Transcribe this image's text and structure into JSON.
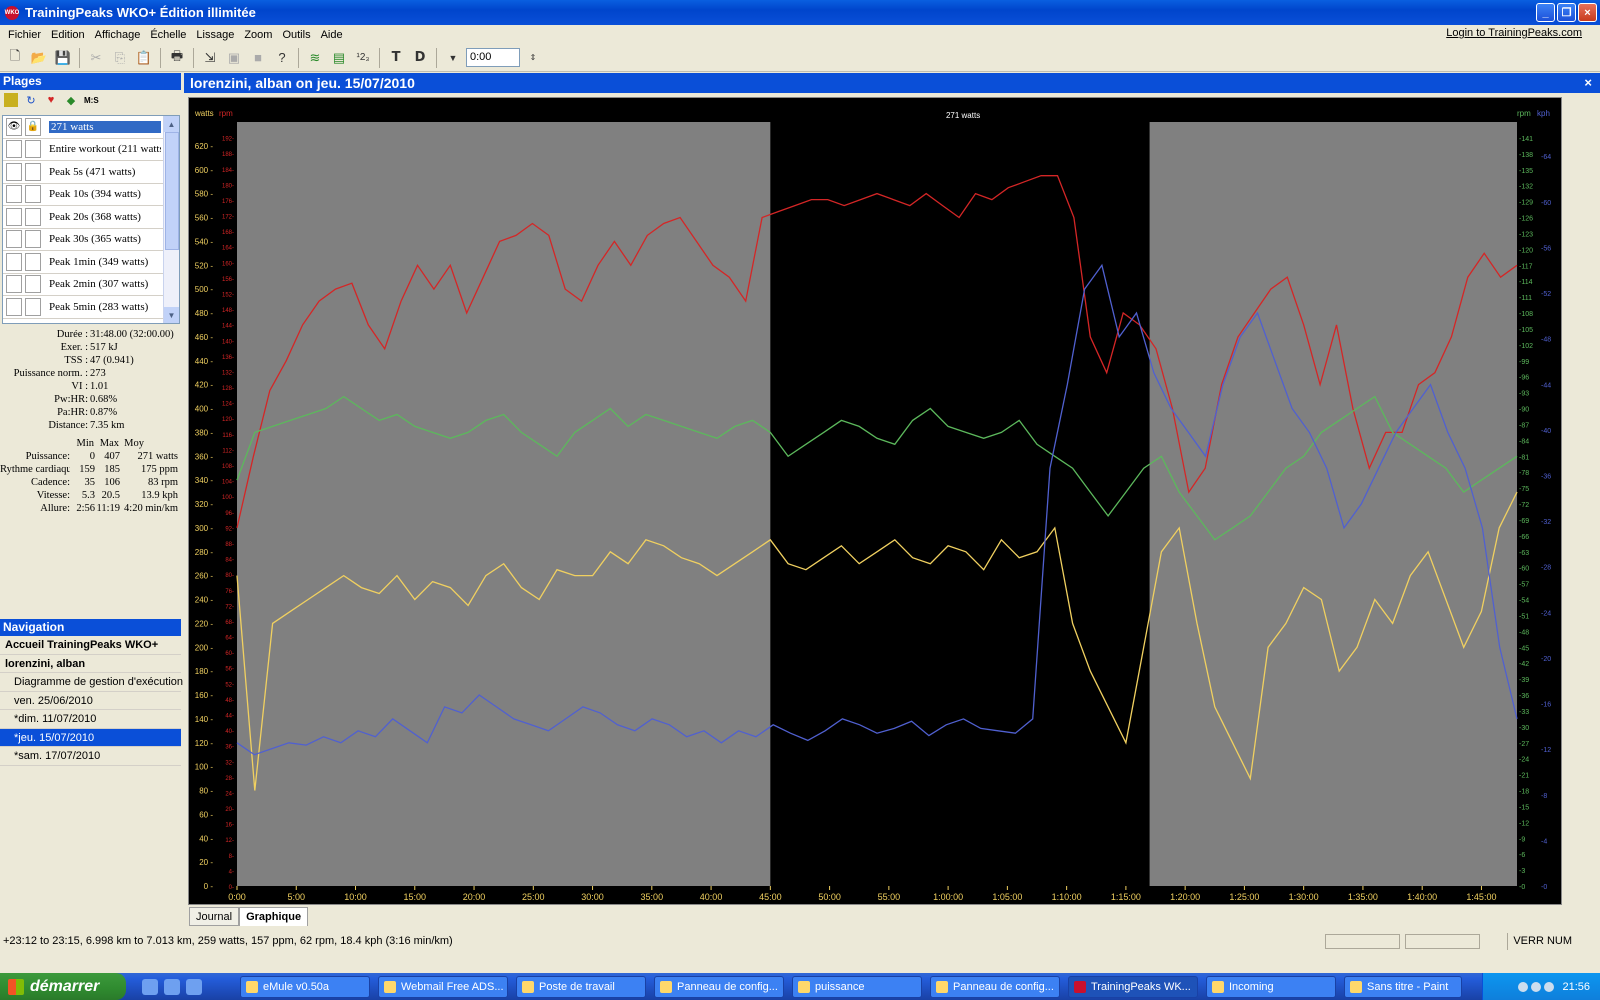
{
  "window": {
    "title": "TrainingPeaks WKO+ Édition illimitée",
    "app_icon": "WKO"
  },
  "menu": {
    "items": [
      "Fichier",
      "Edition",
      "Affichage",
      "Échelle",
      "Lissage",
      "Zoom",
      "Outils",
      "Aide"
    ],
    "login": "Login to TrainingPeaks.com"
  },
  "toolbar": {
    "time_value": "0:00"
  },
  "plages": {
    "header": "Plages",
    "toolbar_label": "M:S",
    "items": [
      {
        "label": "271 watts",
        "selected": true
      },
      {
        "label": "Entire workout (211 watts)"
      },
      {
        "label": "Peak 5s (471 watts)"
      },
      {
        "label": "Peak 10s (394 watts)"
      },
      {
        "label": "Peak 20s (368 watts)"
      },
      {
        "label": "Peak 30s (365 watts)"
      },
      {
        "label": "Peak 1min (349 watts)"
      },
      {
        "label": "Peak 2min (307 watts)"
      },
      {
        "label": "Peak 5min (283 watts)"
      }
    ]
  },
  "stats": {
    "summary": [
      {
        "k": "Durée :",
        "v": "31:48.00 (32:00.00)"
      },
      {
        "k": "Exer. :",
        "v": "517 kJ"
      },
      {
        "k": "TSS :",
        "v": "47 (0.941)"
      },
      {
        "k": "Puissance norm. :",
        "v": "273"
      },
      {
        "k": "VI :",
        "v": "1.01"
      },
      {
        "k": "Pw:HR:",
        "v": "0.68%"
      },
      {
        "k": "Pa:HR:",
        "v": "0.87%"
      },
      {
        "k": "Distance:",
        "v": "7.35 km"
      }
    ],
    "minmax_head": [
      "Min",
      "Max",
      "Moy"
    ],
    "minmax": [
      {
        "k": "Puissance:",
        "min": "0",
        "max": "407",
        "avg": "271 watts"
      },
      {
        "k": "Rythme cardiaque:",
        "min": "159",
        "max": "185",
        "avg": "175 ppm"
      },
      {
        "k": "Cadence:",
        "min": "35",
        "max": "106",
        "avg": "83 rpm"
      },
      {
        "k": "Vitesse:",
        "min": "5.3",
        "max": "20.5",
        "avg": "13.9 kph"
      },
      {
        "k": "Allure:",
        "min": "2:56",
        "max": "11:19",
        "avg": "4:20 min/km"
      }
    ]
  },
  "navigation": {
    "header": "Navigation",
    "items": [
      {
        "label": "Accueil TrainingPeaks WKO+",
        "top": true
      },
      {
        "label": "lorenzini, alban",
        "top": true
      },
      {
        "label": "Diagramme de gestion d'exécution"
      },
      {
        "label": "ven. 25/06/2010"
      },
      {
        "label": "*dim. 11/07/2010"
      },
      {
        "label": "*jeu. 15/07/2010",
        "selected": true
      },
      {
        "label": "*sam. 17/07/2010"
      }
    ]
  },
  "main": {
    "title": "lorenzini, alban on jeu. 15/07/2010",
    "close": "×"
  },
  "tabs": [
    "Journal",
    "Graphique"
  ],
  "status": {
    "text": "+23:12 to 23:15, 6.998 km to 7.013 km, 259 watts, 157 ppm, 62 rpm, 18.4 kph (3:16 min/km)",
    "verr": "VERR NUM"
  },
  "taskbar": {
    "start": "démarrer",
    "tasks": [
      "eMule v0.50a",
      "Webmail Free ADS...",
      "Poste de travail",
      "Panneau de config...",
      "puissance",
      "Panneau de config...",
      "TrainingPeaks WK...",
      "Incoming",
      "Sans titre - Paint"
    ],
    "active_task": 6,
    "clock": "21:56"
  },
  "chart_data": {
    "type": "line",
    "selection_label": "271 watts",
    "selection_range_min": [
      45,
      77
    ],
    "x_range_min": [
      0,
      108
    ],
    "x_ticks": [
      "0:00",
      "5:00",
      "10:00",
      "15:00",
      "20:00",
      "25:00",
      "30:00",
      "35:00",
      "40:00",
      "45:00",
      "50:00",
      "55:00",
      "1:00:00",
      "1:05:00",
      "1:10:00",
      "1:15:00",
      "1:20:00",
      "1:25:00",
      "1:30:00",
      "1:35:00",
      "1:40:00",
      "1:45:00"
    ],
    "y_left_label": "watts",
    "y_left_label2": "rpm",
    "y_left_ticks": [
      0,
      20,
      40,
      60,
      80,
      100,
      120,
      140,
      160,
      180,
      200,
      220,
      240,
      260,
      280,
      300,
      320,
      340,
      360,
      380,
      400,
      420,
      440,
      460,
      480,
      500,
      520,
      540,
      560,
      580,
      600,
      620
    ],
    "y_left2_ticks": [
      0,
      4,
      8,
      12,
      16,
      20,
      24,
      28,
      32,
      36,
      40,
      44,
      48,
      52,
      56,
      60,
      64,
      68,
      72,
      76,
      80,
      84,
      88,
      92,
      96,
      100,
      104,
      108,
      112,
      116,
      120,
      124,
      128,
      132,
      136,
      140,
      144,
      148,
      152,
      156,
      160,
      164,
      168,
      172,
      176,
      180,
      184,
      188,
      192
    ],
    "y_right_label": "rpm",
    "y_right_label2": "kph",
    "y_right_ticks": [
      0,
      3,
      6,
      9,
      12,
      15,
      18,
      21,
      24,
      27,
      30,
      33,
      36,
      39,
      42,
      45,
      48,
      51,
      54,
      57,
      60,
      63,
      66,
      69,
      72,
      75,
      78,
      81,
      84,
      87,
      90,
      93,
      96,
      99,
      102,
      105,
      108,
      111,
      114,
      117,
      120,
      123,
      126,
      129,
      132,
      135,
      138,
      141
    ],
    "y_right2_ticks": [
      0,
      4,
      8,
      12,
      16,
      20,
      24,
      28,
      32,
      36,
      40,
      44,
      48,
      52,
      56,
      60,
      64
    ],
    "series": [
      {
        "name": "Rythme cardiaque",
        "color": "#d42626",
        "values": [
          300,
          360,
          415,
          440,
          470,
          490,
          500,
          505,
          470,
          450,
          490,
          520,
          500,
          520,
          480,
          510,
          540,
          545,
          555,
          545,
          500,
          490,
          520,
          540,
          520,
          545,
          555,
          560,
          540,
          520,
          510,
          490,
          560,
          565,
          570,
          575,
          575,
          570,
          575,
          580,
          575,
          570,
          580,
          570,
          560,
          580,
          575,
          585,
          590,
          595,
          595,
          560,
          460,
          430,
          480,
          470,
          450,
          400,
          330,
          350,
          420,
          460,
          480,
          500,
          510,
          470,
          420,
          470,
          400,
          350,
          380,
          380,
          420,
          430,
          460,
          510,
          530,
          510,
          520
        ]
      },
      {
        "name": "Puissance",
        "color": "#f0d060",
        "values": [
          260,
          80,
          220,
          230,
          240,
          250,
          260,
          250,
          245,
          260,
          240,
          255,
          250,
          235,
          260,
          270,
          250,
          240,
          265,
          260,
          260,
          280,
          270,
          290,
          285,
          275,
          270,
          260,
          270,
          280,
          290,
          270,
          265,
          275,
          285,
          270,
          280,
          290,
          275,
          270,
          285,
          280,
          265,
          290,
          275,
          280,
          300,
          220,
          180,
          150,
          120,
          200,
          280,
          300,
          220,
          150,
          120,
          90,
          200,
          220,
          250,
          240,
          180,
          200,
          240,
          220,
          260,
          280,
          240,
          200,
          230,
          300,
          330
        ]
      },
      {
        "name": "Cadence",
        "color": "#5cb85c",
        "values": [
          340,
          380,
          385,
          390,
          395,
          400,
          410,
          400,
          390,
          395,
          385,
          380,
          375,
          380,
          390,
          395,
          380,
          370,
          360,
          380,
          390,
          400,
          385,
          395,
          390,
          385,
          380,
          375,
          385,
          390,
          380,
          360,
          370,
          380,
          390,
          385,
          375,
          370,
          390,
          400,
          385,
          380,
          375,
          380,
          390,
          370,
          360,
          350,
          330,
          310,
          330,
          350,
          360,
          330,
          310,
          290,
          300,
          310,
          330,
          350,
          360,
          380,
          390,
          400,
          410,
          380,
          370,
          360,
          350,
          330,
          340,
          350,
          360
        ]
      },
      {
        "name": "Vitesse",
        "color": "#5060d0",
        "values": [
          120,
          110,
          115,
          120,
          118,
          125,
          120,
          130,
          125,
          140,
          130,
          120,
          150,
          145,
          160,
          150,
          140,
          135,
          130,
          140,
          150,
          145,
          135,
          130,
          140,
          135,
          125,
          130,
          120,
          130,
          125,
          135,
          128,
          122,
          130,
          140,
          135,
          128,
          132,
          138,
          126,
          135,
          140,
          132,
          130,
          128,
          140,
          350,
          420,
          500,
          520,
          460,
          480,
          430,
          400,
          380,
          360,
          420,
          460,
          480,
          440,
          400,
          380,
          350,
          300,
          320,
          350,
          380,
          400,
          420,
          380,
          350,
          300,
          200,
          140
        ]
      }
    ]
  }
}
